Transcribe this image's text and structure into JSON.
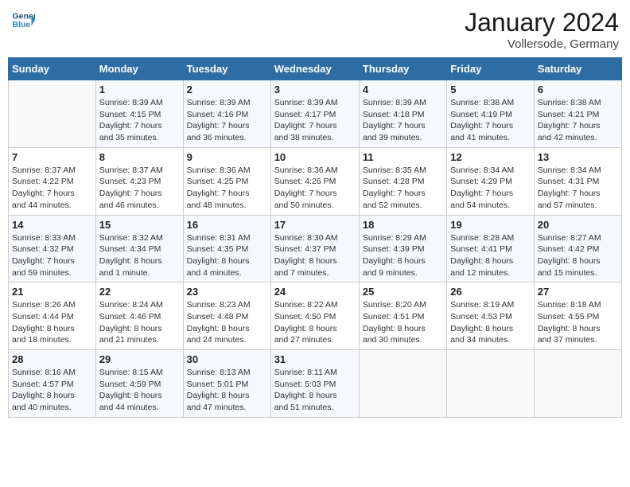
{
  "header": {
    "logo_line1": "General",
    "logo_line2": "Blue",
    "month": "January 2024",
    "location": "Vollersode, Germany"
  },
  "weekdays": [
    "Sunday",
    "Monday",
    "Tuesday",
    "Wednesday",
    "Thursday",
    "Friday",
    "Saturday"
  ],
  "weeks": [
    [
      {
        "day": "",
        "info": ""
      },
      {
        "day": "1",
        "info": "Sunrise: 8:39 AM\nSunset: 4:15 PM\nDaylight: 7 hours\nand 35 minutes."
      },
      {
        "day": "2",
        "info": "Sunrise: 8:39 AM\nSunset: 4:16 PM\nDaylight: 7 hours\nand 36 minutes."
      },
      {
        "day": "3",
        "info": "Sunrise: 8:39 AM\nSunset: 4:17 PM\nDaylight: 7 hours\nand 38 minutes."
      },
      {
        "day": "4",
        "info": "Sunrise: 8:39 AM\nSunset: 4:18 PM\nDaylight: 7 hours\nand 39 minutes."
      },
      {
        "day": "5",
        "info": "Sunrise: 8:38 AM\nSunset: 4:19 PM\nDaylight: 7 hours\nand 41 minutes."
      },
      {
        "day": "6",
        "info": "Sunrise: 8:38 AM\nSunset: 4:21 PM\nDaylight: 7 hours\nand 42 minutes."
      }
    ],
    [
      {
        "day": "7",
        "info": "Sunrise: 8:37 AM\nSunset: 4:22 PM\nDaylight: 7 hours\nand 44 minutes."
      },
      {
        "day": "8",
        "info": "Sunrise: 8:37 AM\nSunset: 4:23 PM\nDaylight: 7 hours\nand 46 minutes."
      },
      {
        "day": "9",
        "info": "Sunrise: 8:36 AM\nSunset: 4:25 PM\nDaylight: 7 hours\nand 48 minutes."
      },
      {
        "day": "10",
        "info": "Sunrise: 8:36 AM\nSunset: 4:26 PM\nDaylight: 7 hours\nand 50 minutes."
      },
      {
        "day": "11",
        "info": "Sunrise: 8:35 AM\nSunset: 4:28 PM\nDaylight: 7 hours\nand 52 minutes."
      },
      {
        "day": "12",
        "info": "Sunrise: 8:34 AM\nSunset: 4:29 PM\nDaylight: 7 hours\nand 54 minutes."
      },
      {
        "day": "13",
        "info": "Sunrise: 8:34 AM\nSunset: 4:31 PM\nDaylight: 7 hours\nand 57 minutes."
      }
    ],
    [
      {
        "day": "14",
        "info": "Sunrise: 8:33 AM\nSunset: 4:32 PM\nDaylight: 7 hours\nand 59 minutes."
      },
      {
        "day": "15",
        "info": "Sunrise: 8:32 AM\nSunset: 4:34 PM\nDaylight: 8 hours\nand 1 minute."
      },
      {
        "day": "16",
        "info": "Sunrise: 8:31 AM\nSunset: 4:35 PM\nDaylight: 8 hours\nand 4 minutes."
      },
      {
        "day": "17",
        "info": "Sunrise: 8:30 AM\nSunset: 4:37 PM\nDaylight: 8 hours\nand 7 minutes."
      },
      {
        "day": "18",
        "info": "Sunrise: 8:29 AM\nSunset: 4:39 PM\nDaylight: 8 hours\nand 9 minutes."
      },
      {
        "day": "19",
        "info": "Sunrise: 8:28 AM\nSunset: 4:41 PM\nDaylight: 8 hours\nand 12 minutes."
      },
      {
        "day": "20",
        "info": "Sunrise: 8:27 AM\nSunset: 4:42 PM\nDaylight: 8 hours\nand 15 minutes."
      }
    ],
    [
      {
        "day": "21",
        "info": "Sunrise: 8:26 AM\nSunset: 4:44 PM\nDaylight: 8 hours\nand 18 minutes."
      },
      {
        "day": "22",
        "info": "Sunrise: 8:24 AM\nSunset: 4:46 PM\nDaylight: 8 hours\nand 21 minutes."
      },
      {
        "day": "23",
        "info": "Sunrise: 8:23 AM\nSunset: 4:48 PM\nDaylight: 8 hours\nand 24 minutes."
      },
      {
        "day": "24",
        "info": "Sunrise: 8:22 AM\nSunset: 4:50 PM\nDaylight: 8 hours\nand 27 minutes."
      },
      {
        "day": "25",
        "info": "Sunrise: 8:20 AM\nSunset: 4:51 PM\nDaylight: 8 hours\nand 30 minutes."
      },
      {
        "day": "26",
        "info": "Sunrise: 8:19 AM\nSunset: 4:53 PM\nDaylight: 8 hours\nand 34 minutes."
      },
      {
        "day": "27",
        "info": "Sunrise: 8:18 AM\nSunset: 4:55 PM\nDaylight: 8 hours\nand 37 minutes."
      }
    ],
    [
      {
        "day": "28",
        "info": "Sunrise: 8:16 AM\nSunset: 4:57 PM\nDaylight: 8 hours\nand 40 minutes."
      },
      {
        "day": "29",
        "info": "Sunrise: 8:15 AM\nSunset: 4:59 PM\nDaylight: 8 hours\nand 44 minutes."
      },
      {
        "day": "30",
        "info": "Sunrise: 8:13 AM\nSunset: 5:01 PM\nDaylight: 8 hours\nand 47 minutes."
      },
      {
        "day": "31",
        "info": "Sunrise: 8:11 AM\nSunset: 5:03 PM\nDaylight: 8 hours\nand 51 minutes."
      },
      {
        "day": "",
        "info": ""
      },
      {
        "day": "",
        "info": ""
      },
      {
        "day": "",
        "info": ""
      }
    ]
  ]
}
